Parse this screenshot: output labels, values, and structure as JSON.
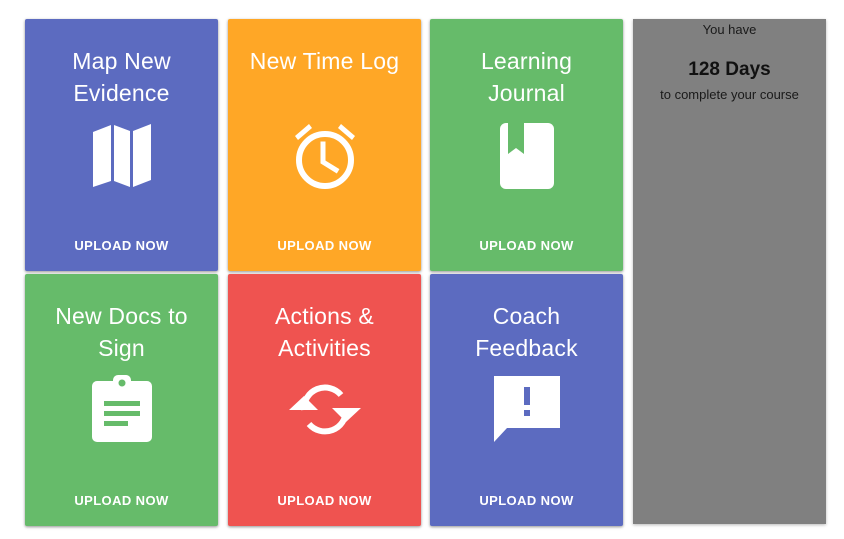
{
  "colors": {
    "blue": "#5c6bc0",
    "orange": "#ffa726",
    "green": "#66bb6a",
    "red": "#ef5350",
    "panel_gray": "#808080"
  },
  "tiles": [
    {
      "title": "Map New Evidence",
      "cta": "UPLOAD NOW",
      "icon": "map-icon",
      "color": "#5c6bc0"
    },
    {
      "title": "New Time Log",
      "cta": "UPLOAD NOW",
      "icon": "alarm-clock-icon",
      "color": "#ffa726"
    },
    {
      "title": "Learning Journal",
      "cta": "UPLOAD NOW",
      "icon": "bookmark-book-icon",
      "color": "#66bb6a"
    },
    {
      "title": "New Docs to Sign",
      "cta": "UPLOAD NOW",
      "icon": "clipboard-icon",
      "color": "#66bb6a"
    },
    {
      "title": "Actions & Activities",
      "cta": "UPLOAD NOW",
      "icon": "sync-icon",
      "color": "#ef5350"
    },
    {
      "title": "Coach Feedback",
      "cta": "UPLOAD NOW",
      "icon": "feedback-icon",
      "color": "#5c6bc0"
    }
  ],
  "countdown": {
    "intro": "You have",
    "days": "128 Days",
    "suffix": "to complete your course"
  }
}
